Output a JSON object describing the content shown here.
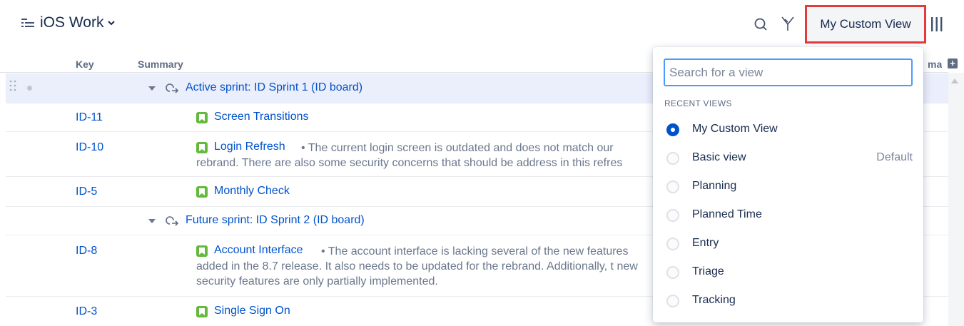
{
  "header": {
    "title": "iOS Work",
    "active_view_label": "My Custom View"
  },
  "table": {
    "columns": {
      "key": "Key",
      "summary": "Summary",
      "estimate_partial": "mat"
    },
    "groups": [
      {
        "title": "Active sprint: ID Sprint 1 (ID board)"
      },
      {
        "title": "Future sprint: ID Sprint 2 (ID board)"
      }
    ],
    "rows": [
      {
        "key": "ID-11",
        "title": "Screen Transitions",
        "desc": ""
      },
      {
        "key": "ID-10",
        "title": "Login Refresh",
        "desc": "The current login screen is outdated and does not match our rebrand. There are also some security concerns that should be address in this refres"
      },
      {
        "key": "ID-5",
        "title": "Monthly Check",
        "desc": ""
      },
      {
        "key": "ID-8",
        "title": "Account Interface",
        "desc": "The account interface is lacking several of the new features added in the 8.7 release. It also needs to be updated for the rebrand. Additionally, t new security features are only partially implemented."
      },
      {
        "key": "ID-3",
        "title": "Single Sign On",
        "desc": ""
      }
    ]
  },
  "dropdown": {
    "search_placeholder": "Search for a view",
    "recent_heading": "RECENT VIEWS",
    "default_label": "Default",
    "options": [
      {
        "label": "My Custom View",
        "selected": true
      },
      {
        "label": "Basic view",
        "selected": false
      },
      {
        "label": "Planning",
        "selected": false
      },
      {
        "label": "Planned Time",
        "selected": false
      },
      {
        "label": "Entry",
        "selected": false
      },
      {
        "label": "Triage",
        "selected": false
      },
      {
        "label": "Tracking",
        "selected": false
      }
    ]
  },
  "colors": {
    "accent": "#0052cc",
    "story": "#63ba3c",
    "highlight": "#e23b3b"
  }
}
